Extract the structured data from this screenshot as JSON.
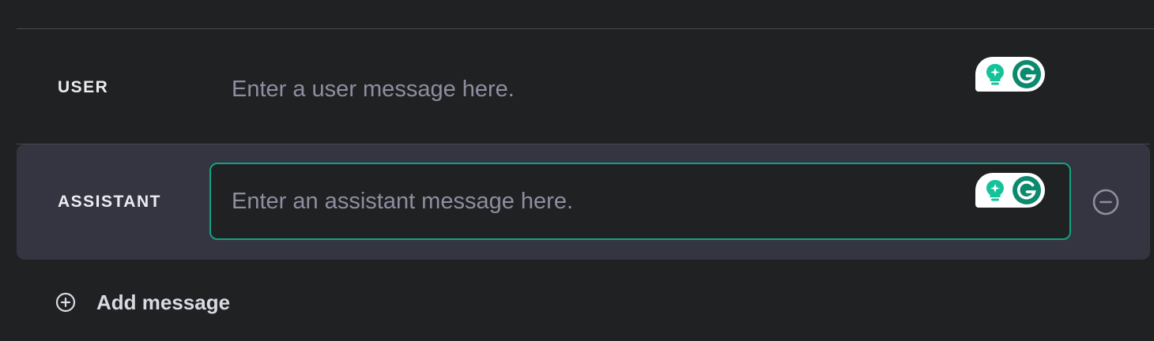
{
  "messages": [
    {
      "role": "USER",
      "placeholder": "Enter a user message here.",
      "value": ""
    },
    {
      "role": "ASSISTANT",
      "placeholder": "Enter an assistant message here.",
      "value": ""
    }
  ],
  "add_message": {
    "label": "Add message",
    "icon": "plus-circle-icon"
  },
  "remove_message": {
    "icon": "minus-circle-icon"
  },
  "grammarly_widget": {
    "icons": [
      "lightbulb-icon",
      "grammarly-g-icon"
    ]
  },
  "colors": {
    "background": "#202123",
    "active_row": "#343541",
    "accent": "#10a37f",
    "grammarly_green": "#15c39a",
    "grammarly_dark": "#0c8a6e",
    "text": "#ececf1",
    "placeholder": "#8e8ea0"
  }
}
